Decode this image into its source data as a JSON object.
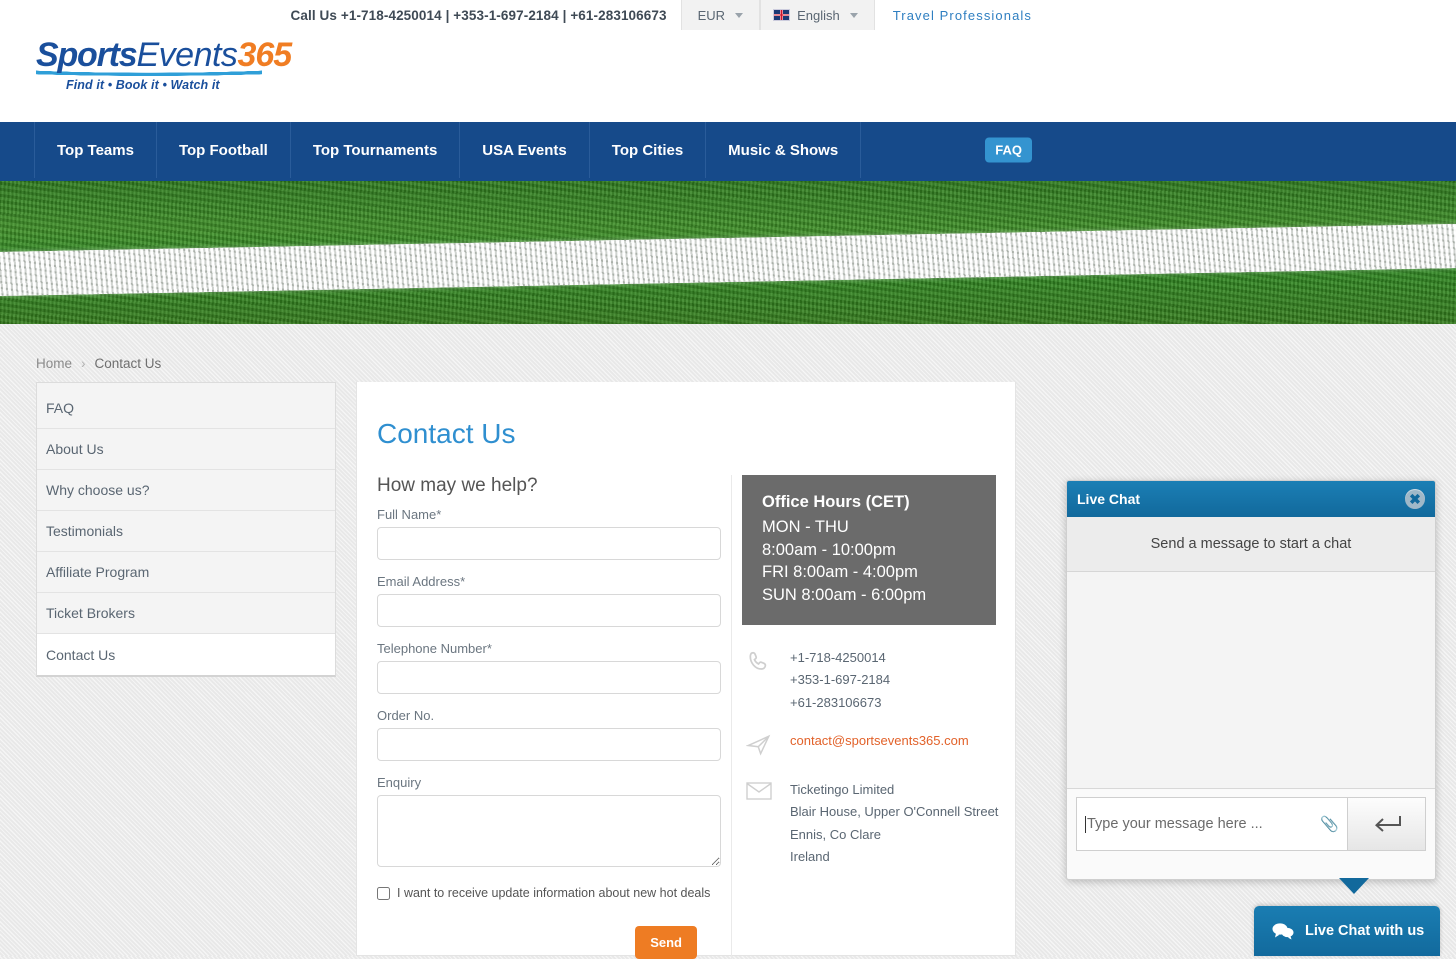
{
  "topbar": {
    "call_us": "Call Us +1-718-4250014 | +353-1-697-2184 | +61-283106673",
    "currency": "EUR",
    "language": "English",
    "travel_professionals": "Travel Professionals"
  },
  "logo": {
    "part1": "Sports",
    "part2": "Events",
    "part3": "365",
    "tagline": "Find it • Book it • Watch it"
  },
  "nav": {
    "items": [
      {
        "label": "Top Teams"
      },
      {
        "label": "Top Football"
      },
      {
        "label": "Top Tournaments"
      },
      {
        "label": "USA Events"
      },
      {
        "label": "Top Cities"
      },
      {
        "label": "Music & Shows"
      }
    ],
    "faq_label": "FAQ"
  },
  "breadcrumb": {
    "home": "Home",
    "separator": "›",
    "current": "Contact Us"
  },
  "sidebar": {
    "items": [
      {
        "label": "FAQ",
        "active": false
      },
      {
        "label": "About Us",
        "active": false
      },
      {
        "label": "Why choose us?",
        "active": false
      },
      {
        "label": "Testimonials",
        "active": false
      },
      {
        "label": "Affiliate Program",
        "active": false
      },
      {
        "label": "Ticket Brokers",
        "active": false
      },
      {
        "label": "Contact Us",
        "active": true
      }
    ]
  },
  "main": {
    "title": "Contact Us",
    "form_heading": "How may we help?",
    "fields": {
      "full_name_label": "Full Name*",
      "full_name_value": "",
      "email_label": "Email Address*",
      "email_value": "",
      "telephone_label": "Telephone Number*",
      "telephone_value": "",
      "order_label": "Order No.",
      "order_value": "",
      "enquiry_label": "Enquiry",
      "enquiry_value": ""
    },
    "newsletter_label": "I want to receive update information about new hot deals",
    "send_label": "Send"
  },
  "office_hours": {
    "title": "Office Hours (CET)",
    "line1": "MON - THU",
    "line2": "8:00am - 10:00pm",
    "line3": "FRI 8:00am - 4:00pm",
    "line4": "SUN 8:00am - 6:00pm"
  },
  "contact": {
    "phones": [
      "+1-718-4250014",
      "+353-1-697-2184",
      "+61-283106673"
    ],
    "email": "contact@sportsevents365.com",
    "address": [
      "Ticketingo Limited",
      "Blair House, Upper O'Connell Street",
      "Ennis, Co Clare",
      "Ireland"
    ]
  },
  "live_chat": {
    "title": "Live Chat",
    "notice": "Send a message to start a chat",
    "input_placeholder": "Type your message here ...",
    "cta_label": "Live Chat with us"
  },
  "colors": {
    "nav_blue": "#164a8a",
    "accent_blue": "#2f8fd0",
    "orange": "#ee7c23",
    "chat_blue": "#12699c",
    "logo_orange": "#f07d23"
  }
}
